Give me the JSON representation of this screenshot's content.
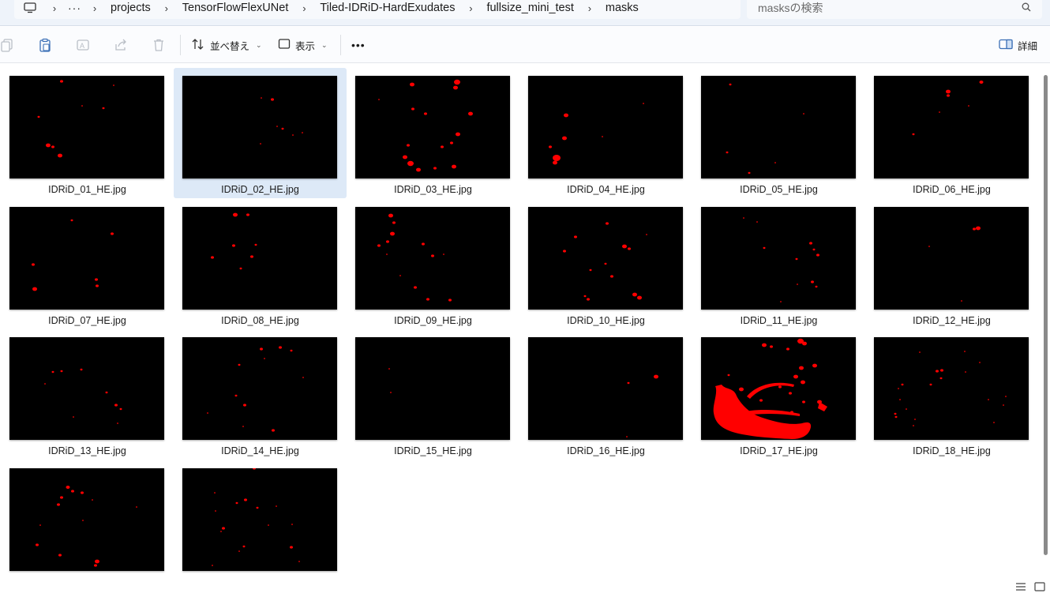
{
  "breadcrumb": {
    "more": "···",
    "items": [
      "projects",
      "TensorFlowFlexUNet",
      "Tiled-IDRiD-HardExudates",
      "fullsize_mini_test",
      "masks"
    ]
  },
  "search": {
    "placeholder": "masksの検索"
  },
  "toolbar": {
    "sort_label": "並べ替え",
    "view_label": "表示",
    "more_label": "•••",
    "details_label": "詳細"
  },
  "files": [
    {
      "name": "IDRiD_01_HE.jpg",
      "selected": false
    },
    {
      "name": "IDRiD_02_HE.jpg",
      "selected": true
    },
    {
      "name": "IDRiD_03_HE.jpg",
      "selected": false
    },
    {
      "name": "IDRiD_04_HE.jpg",
      "selected": false
    },
    {
      "name": "IDRiD_05_HE.jpg",
      "selected": false
    },
    {
      "name": "IDRiD_06_HE.jpg",
      "selected": false
    },
    {
      "name": "IDRiD_07_HE.jpg",
      "selected": false
    },
    {
      "name": "IDRiD_08_HE.jpg",
      "selected": false
    },
    {
      "name": "IDRiD_09_HE.jpg",
      "selected": false
    },
    {
      "name": "IDRiD_10_HE.jpg",
      "selected": false
    },
    {
      "name": "IDRiD_11_HE.jpg",
      "selected": false
    },
    {
      "name": "IDRiD_12_HE.jpg",
      "selected": false
    },
    {
      "name": "IDRiD_13_HE.jpg",
      "selected": false
    },
    {
      "name": "IDRiD_14_HE.jpg",
      "selected": false
    },
    {
      "name": "IDRiD_15_HE.jpg",
      "selected": false
    },
    {
      "name": "IDRiD_16_HE.jpg",
      "selected": false
    },
    {
      "name": "IDRiD_17_HE.jpg",
      "selected": false
    },
    {
      "name": "IDRiD_18_HE.jpg",
      "selected": false
    },
    {
      "name": "",
      "selected": false
    },
    {
      "name": "",
      "selected": false
    }
  ],
  "colors": {
    "mask_red": "#ff0000",
    "selection": "#dde9f7",
    "thumb_bg": "#000000"
  }
}
